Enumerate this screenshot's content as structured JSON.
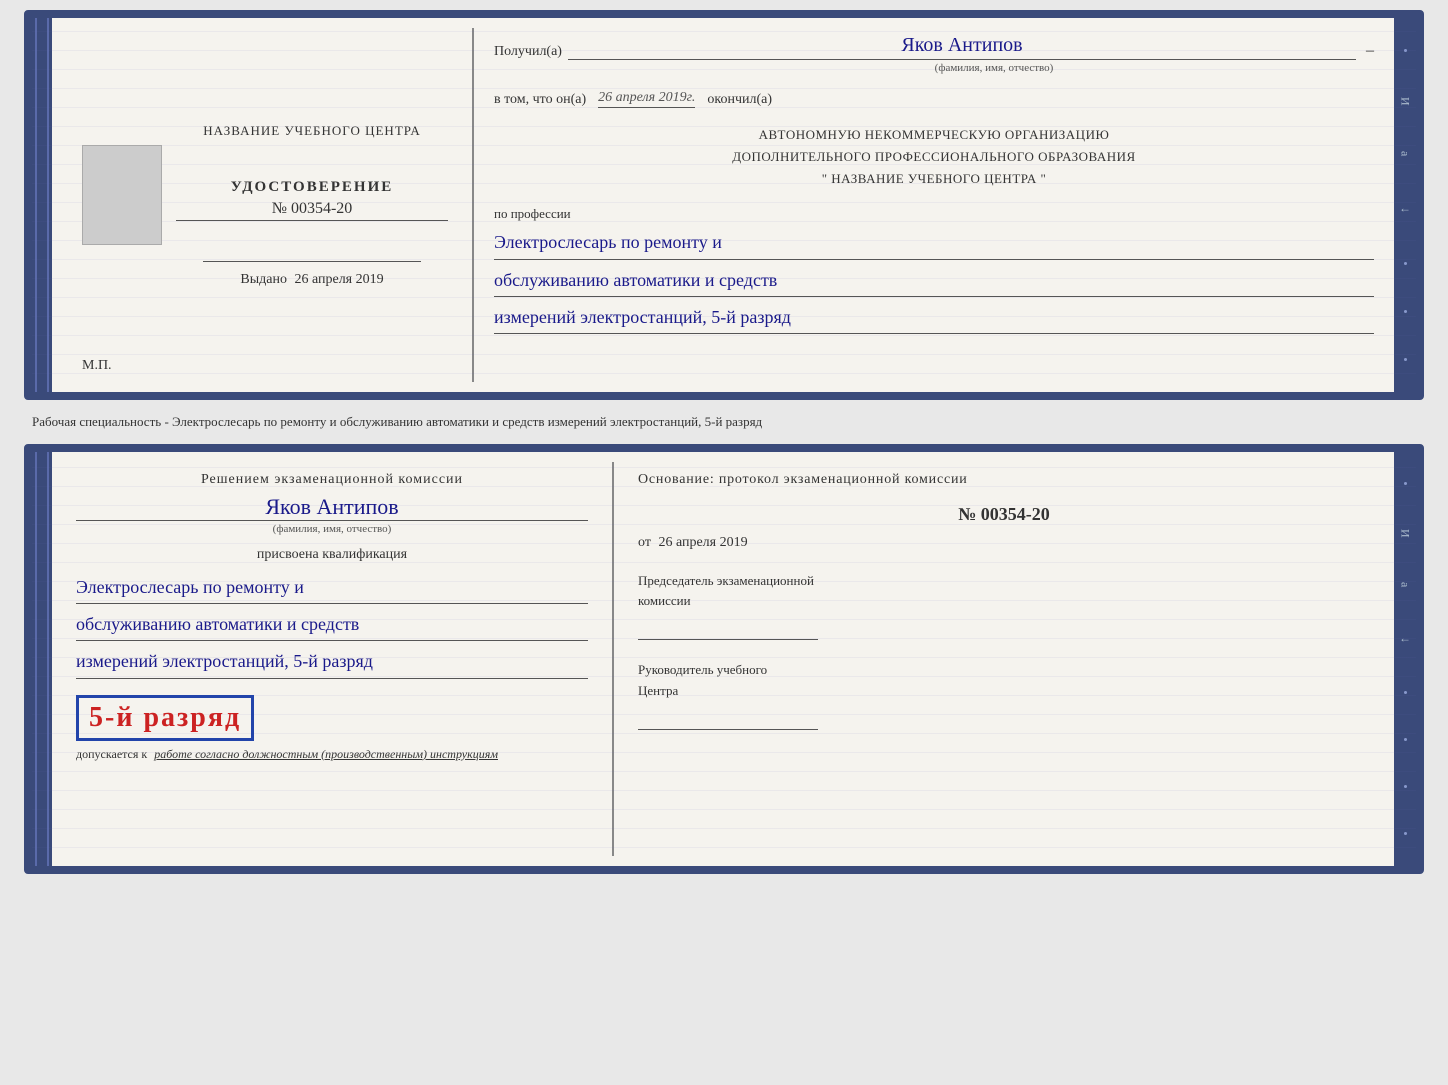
{
  "top_doc": {
    "left": {
      "school_label": "НАЗВАНИЕ УЧЕБНОГО ЦЕНТРА",
      "udostoverenie": "УДОСТОВЕРЕНИЕ",
      "number": "№ 00354-20",
      "vydano_prefix": "Выдано",
      "vydano_date": "26 апреля 2019",
      "mp": "М.П."
    },
    "right": {
      "poluchil": "Получил(а)",
      "name_handwritten": "Яков Антипов",
      "fio_label": "(фамилия, имя, отчество)",
      "dash": "–",
      "vtom": "в том, что он(а)",
      "date_handwritten": "26 апреля 2019г.",
      "okonchil": "окончил(а)",
      "org_line1": "АВТОНОМНУЮ НЕКОММЕРЧЕСКУЮ ОРГАНИЗАЦИЮ",
      "org_line2": "ДОПОЛНИТЕЛЬНОГО ПРОФЕССИОНАЛЬНОГО ОБРАЗОВАНИЯ",
      "org_line3": "\"   НАЗВАНИЕ УЧЕБНОГО ЦЕНТРА   \"",
      "po_professii": "по профессии",
      "profession_line1": "Электрослесарь по ремонту и",
      "profession_line2": "обслуживанию автоматики и средств",
      "profession_line3": "измерений электростанций, 5-й разряд"
    }
  },
  "separator": {
    "text": "Рабочая специальность - Электрослесарь по ремонту и обслуживанию автоматики и средств измерений электростанций, 5-й разряд"
  },
  "bottom_doc": {
    "left": {
      "resheniye": "Решением экзаменационной комиссии",
      "name_handwritten": "Яков Антипов",
      "fio_label": "(фамилия, имя, отчество)",
      "prisvoyena": "присвоена квалификация",
      "qual_line1": "Электрослесарь по ремонту и",
      "qual_line2": "обслуживанию автоматики и средств",
      "qual_line3": "измерений электростанций, 5-й разряд",
      "razryad": "5-й разряд",
      "dopuskaetsya_prefix": "допускается к",
      "dopuskaetsya_italic": "работе согласно должностным (производственным) инструкциям"
    },
    "right": {
      "osnovaniye": "Основание: протокол экзаменационной комиссии",
      "number": "№  00354-20",
      "ot_prefix": "от",
      "ot_date": "26 апреля 2019",
      "predsedatel_line1": "Председатель экзаменационной",
      "predsedatel_line2": "комиссии",
      "rukovoditel_line1": "Руководитель учебного",
      "rukovoditel_line2": "Центра"
    }
  }
}
